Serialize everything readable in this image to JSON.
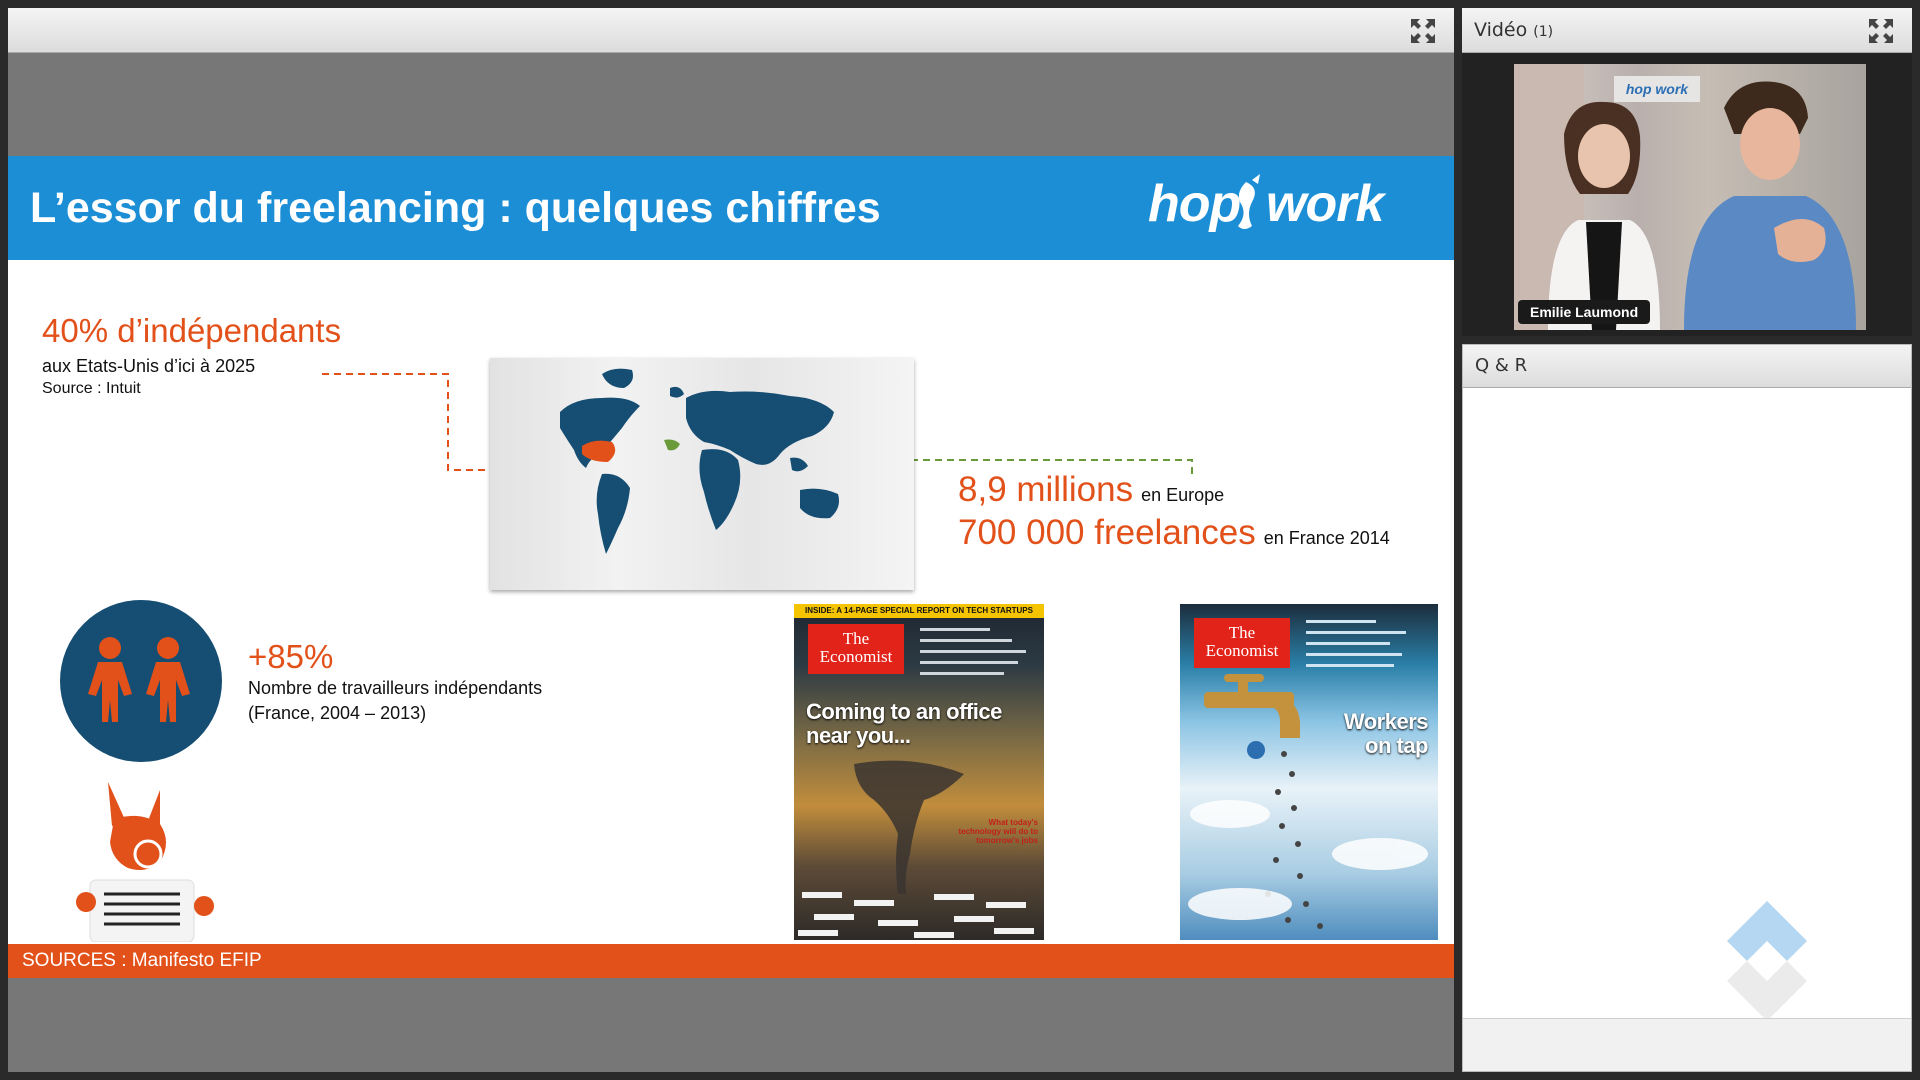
{
  "presentation": {
    "title": "",
    "slide": {
      "title": "L’essor du freelancing : quelques chiffres",
      "logo": "hop work",
      "stat_us": {
        "headline": "40% d’indépendants",
        "detail": "aux Etats-Unis d’ici à 2025",
        "source": "Source : Intuit"
      },
      "stat_europe": {
        "value": "8,9 millions",
        "suffix": "en Europe"
      },
      "stat_france": {
        "value": "700 000 freelances",
        "suffix": "en France 2014"
      },
      "stat_growth": {
        "value": "+85%",
        "line1": "Nombre de travailleurs indépendants",
        "line2": "(France, 2004 – 2013)"
      },
      "covers": [
        {
          "ribbon": "INSIDE: A 14-PAGE SPECIAL REPORT ON TECH STARTUPS",
          "brand": "The Economist",
          "headline_line1": "Coming to an office",
          "headline_line2": "near you...",
          "caption_lines": [
            "What today's",
            "technology will do to",
            "tomorrow's jobs"
          ]
        },
        {
          "brand": "The Economist",
          "headline_line1": "Workers",
          "headline_line2": "on tap"
        }
      ],
      "footer": "SOURCES : Manifesto EFIP"
    }
  },
  "video": {
    "title": "Vidéo",
    "count": "(1)",
    "participant": "Emilie Laumond",
    "background_sign": "hop work"
  },
  "qa": {
    "title": "Q & R"
  },
  "colors": {
    "slide_blue": "#1c8ed6",
    "accent_orange": "#e2511a",
    "map_navy": "#154d73",
    "frame_grey": "#777777"
  }
}
